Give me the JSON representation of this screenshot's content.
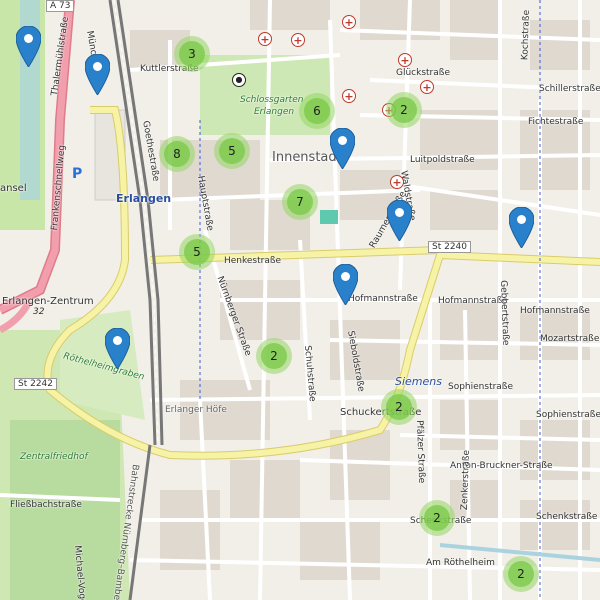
{
  "map": {
    "districts": {
      "innenstadt": "Innenstadt",
      "erlangen": "Erlangen",
      "siemens": "Siemens",
      "zentrum": "Erlangen-Zentrum"
    },
    "parks": {
      "schlossgarten_line1": "Schlossgarten",
      "schlossgarten_line2": "Erlangen",
      "zentralfriedhof": "Zentralfriedhof",
      "rathsberg": "Röthelheimgraben"
    },
    "streets": {
      "kuttlerstrasse": "Kuttlerstraße",
      "glueckstrasse": "Glückstraße",
      "schillerstrasse": "Schillerstraße",
      "fichtestrasse": "Fichtestraße",
      "luitpoldstrasse": "Luitpoldstraße",
      "henkestrasse": "Henkestraße",
      "hofmannstrasse1": "Hofmannstraße",
      "hofmannstrasse2": "Hofmannstraße",
      "hofmannstrasse3": "Hofmannstraße",
      "mozartstrasse": "Mozartstraße",
      "sophienstrasse1": "Sophienstraße",
      "sophienstrasse2": "Sophienstraße",
      "schuckertstrasse": "Schuckertstraße",
      "anton_bruckner": "Anton-Bruckner-Straße",
      "schenkstrasse1": "Schenkstraße",
      "schenkstrasse2": "Schenkstraße",
      "am_roethelheim": "Am Röthelheim",
      "fliessbachstrasse": "Fließbachstraße",
      "frankenschnellweg": "Frankenschnellweg",
      "thalermuehlstrasse": "Thalermühlstraße",
      "goethestrasse": "Goethestraße",
      "hauptstrasse": "Hauptstraße",
      "nuernberger": "Nürnberger Straße",
      "schuhstrasse": "Schuhstraße",
      "sieboldstrasse": "Sieboldstraße",
      "raumerstrasse": "Raumerstraße",
      "waldstrasse": "Waldstraße",
      "gebbertstrasse": "Gebbertstraße",
      "pfaelzer": "Pfälzer Straße",
      "zenkerstrasse": "Zenkerstraße",
      "kochstrasse": "Kochstraße",
      "erlanger_hoefe": "Erlanger Höfe",
      "michael": "Michael-Vogel-",
      "bahn": "Bahnstrecke Nürnberg–Bamberg",
      "muench": "Münchener",
      "ansel": "ansel"
    },
    "shields": {
      "a73": "A 73",
      "st2240": "St 2240",
      "st2242": "St 2242",
      "r32": "32"
    },
    "parking_symbol": "P"
  },
  "clusters": [
    {
      "count": "3"
    },
    {
      "count": "6"
    },
    {
      "count": "2"
    },
    {
      "count": "8"
    },
    {
      "count": "5"
    },
    {
      "count": "7"
    },
    {
      "count": "5"
    },
    {
      "count": "2"
    },
    {
      "count": "2"
    },
    {
      "count": "2"
    },
    {
      "count": "2"
    }
  ],
  "marker_count": 7,
  "colors": {
    "cluster_outer": "#96d664",
    "cluster_inner": "#78c846",
    "pin": "#2a81cb",
    "primary_road": "#f7f3a6",
    "hospital": "#c0392b"
  }
}
